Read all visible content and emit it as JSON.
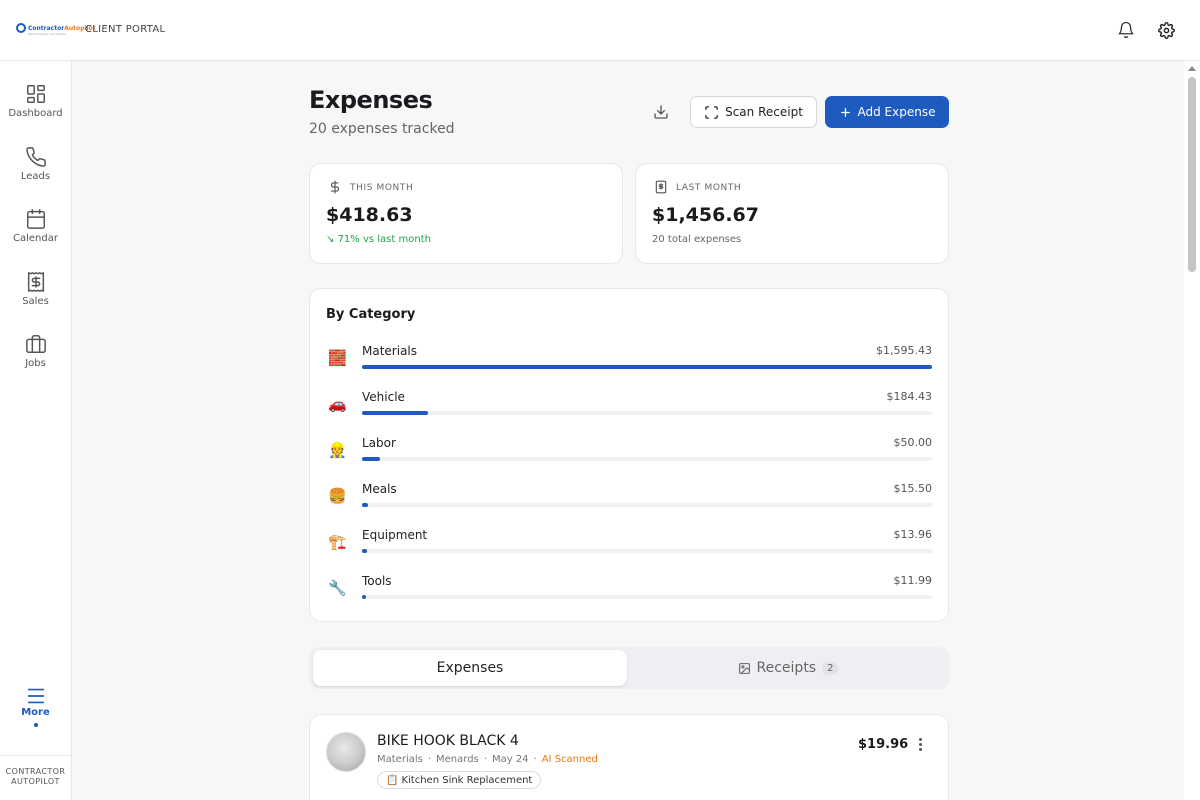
{
  "brand": {
    "logo_a": "Contractor",
    "logo_b": "Autopilot",
    "logo_tagline": "Work smarter, not harder",
    "portal_label": "CLIENT PORTAL"
  },
  "sidebar": {
    "items": [
      {
        "label": "Dashboard",
        "icon": "dashboard-icon"
      },
      {
        "label": "Leads",
        "icon": "phone-icon"
      },
      {
        "label": "Calendar",
        "icon": "calendar-icon"
      },
      {
        "label": "Sales",
        "icon": "receipt-dollar-icon"
      },
      {
        "label": "Jobs",
        "icon": "briefcase-icon"
      }
    ],
    "more_label": "More",
    "footer_line1": "CONTRACTOR",
    "footer_line2": "AUTOPILOT"
  },
  "header": {
    "title": "Expenses",
    "subtitle": "20 expenses tracked",
    "scan_label": "Scan Receipt",
    "add_label": "Add Expense"
  },
  "stats": {
    "this_month": {
      "label": "THIS MONTH",
      "value": "$418.63",
      "note": "71% vs last month"
    },
    "last_month": {
      "label": "LAST MONTH",
      "value": "$1,456.67",
      "note": "20 total expenses"
    }
  },
  "by_category": {
    "title": "By Category",
    "items": [
      {
        "emoji": "🧱",
        "name": "Materials",
        "amount": "$1,595.43",
        "fraction": 1.0
      },
      {
        "emoji": "🚗",
        "name": "Vehicle",
        "amount": "$184.43",
        "fraction": 0.1156
      },
      {
        "emoji": "👷",
        "name": "Labor",
        "amount": "$50.00",
        "fraction": 0.0313
      },
      {
        "emoji": "🍔",
        "name": "Meals",
        "amount": "$15.50",
        "fraction": 0.0097
      },
      {
        "emoji": "🏗️",
        "name": "Equipment",
        "amount": "$13.96",
        "fraction": 0.0087
      },
      {
        "emoji": "🔧",
        "name": "Tools",
        "amount": "$11.99",
        "fraction": 0.0075
      }
    ]
  },
  "tabs": {
    "expenses_label": "Expenses",
    "receipts_label": "Receipts",
    "receipts_count": "2"
  },
  "expense": {
    "title": "BIKE HOOK BLACK 4",
    "category": "Materials",
    "vendor": "Menards",
    "date": "May 24",
    "ai_tag": "AI Scanned",
    "job_emoji": "📋",
    "job": "Kitchen Sink Replacement",
    "amount": "$19.96"
  },
  "colors": {
    "accent": "#1d5bbf",
    "positive": "#1fa34a",
    "ai": "#e8780f"
  }
}
